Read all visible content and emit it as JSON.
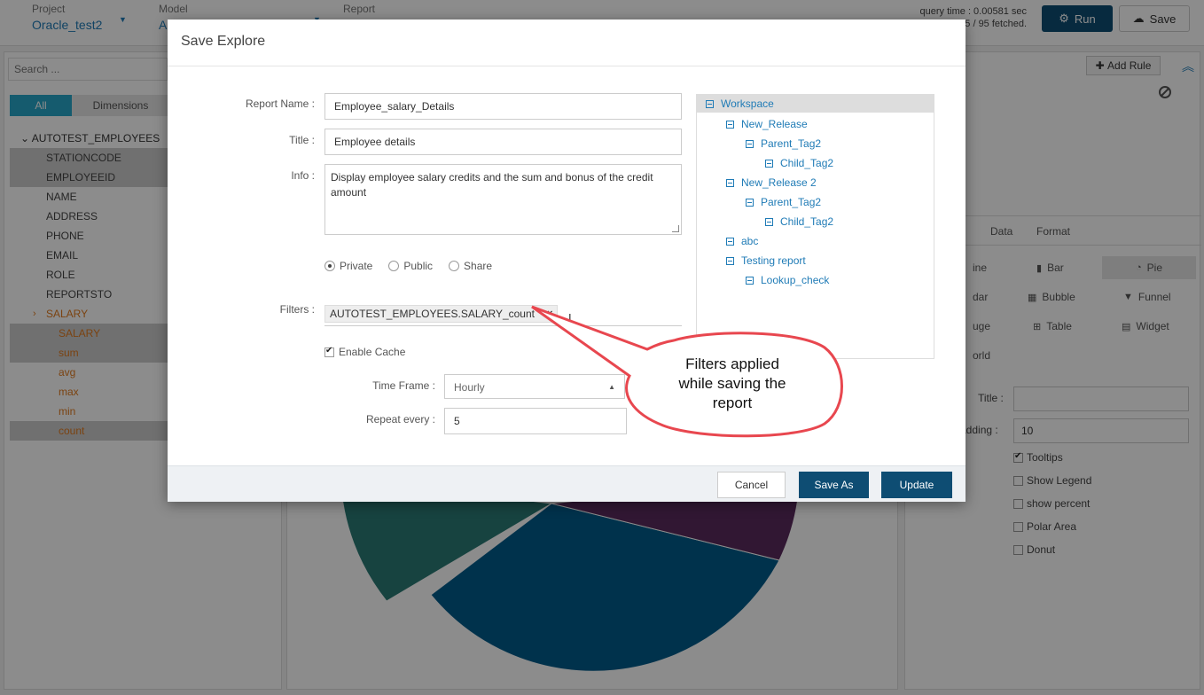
{
  "topbar": {
    "project_label": "Project",
    "project_value": "Oracle_test2",
    "model_label": "Model",
    "model_value": "A",
    "report_label": "Report",
    "query_time": "query time : 0.00581 sec",
    "fetched": "5 / 95 fetched.",
    "run_label": "Run",
    "save_label": "Save"
  },
  "left_panel": {
    "search_placeholder": "Search ...",
    "tab_all": "All",
    "tab_dimensions": "Dimensions",
    "table_name": "AUTOTEST_EMPLOYEES",
    "fields": [
      {
        "label": "STATIONCODE"
      },
      {
        "label": "EMPLOYEEID"
      },
      {
        "label": "NAME"
      },
      {
        "label": "ADDRESS"
      },
      {
        "label": "PHONE"
      },
      {
        "label": "EMAIL"
      },
      {
        "label": "ROLE"
      },
      {
        "label": "REPORTSTO"
      },
      {
        "label": "SALARY"
      },
      {
        "label": "SALARY"
      },
      {
        "label": "sum"
      },
      {
        "label": "avg"
      },
      {
        "label": "max"
      },
      {
        "label": "min"
      },
      {
        "label": "count"
      }
    ]
  },
  "right_panel": {
    "add_rule": "Add Rule",
    "tab_data": "Data",
    "tab_format": "Format",
    "chart_types": [
      "ine",
      "Bar",
      "Pie",
      "dar",
      "Bubble",
      "Funnel",
      "uge",
      "Table",
      "Widget",
      "orld"
    ],
    "title_label": "Title :",
    "padding_label": "adding :",
    "padding_value": "10",
    "checks": [
      "Tooltips",
      "Show Legend",
      "show percent",
      "Polar Area",
      "Donut"
    ]
  },
  "modal": {
    "title": "Save Explore",
    "report_name_label": "Report Name :",
    "report_name_value": "Employee_salary_Details",
    "title_label": "Title :",
    "title_value": "Employee details",
    "info_label": "Info :",
    "info_value": "Display employee salary credits and the sum and bonus of the credit amount",
    "visibility": {
      "private": "Private",
      "public": "Public",
      "share": "Share"
    },
    "filters_label": "Filters :",
    "filter_tag": "AUTOTEST_EMPLOYEES.SALARY_count",
    "filter_remove": "×",
    "enable_cache": "Enable Cache",
    "time_frame_label": "Time Frame :",
    "time_frame_value": "Hourly",
    "repeat_label": "Repeat every :",
    "repeat_value": "5",
    "tree": {
      "root": "Workspace",
      "nodes": [
        "New_Release",
        "Parent_Tag2",
        "Child_Tag2",
        "New_Release 2",
        "Parent_Tag2",
        "Child_Tag2",
        "abc",
        "Testing report",
        "Lookup_check"
      ]
    },
    "cancel": "Cancel",
    "save_as": "Save As",
    "update": "Update"
  },
  "callout": {
    "line1": "Filters applied",
    "line2": "while saving the",
    "line3": "report"
  },
  "colors": {
    "primary_button": "#0e4d73",
    "tab_active": "#27a7c9",
    "link_blue": "#1f7bb6",
    "measure_orange": "#e07a1f",
    "callout_red": "#e8474f",
    "pie_blue": "#005b8a",
    "pie_teal": "#2b7a76",
    "pie_purple": "#5a2a5e"
  }
}
